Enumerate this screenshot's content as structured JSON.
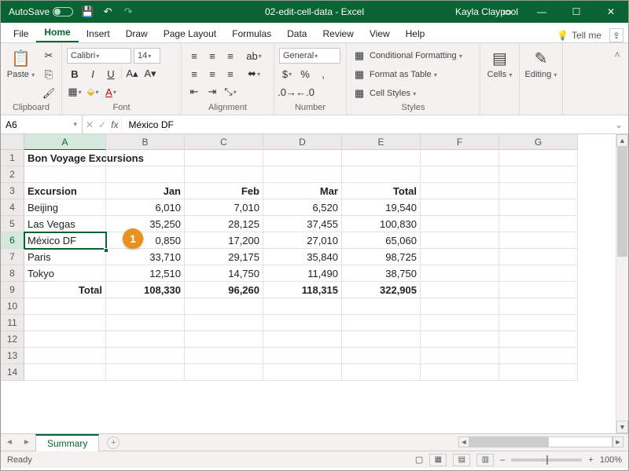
{
  "titlebar": {
    "autosave_label": "AutoSave",
    "autosave_state": "Off",
    "doc_title": "02-edit-cell-data - Excel",
    "user_name": "Kayla Claypool"
  },
  "tabs": {
    "file": "File",
    "home": "Home",
    "insert": "Insert",
    "draw": "Draw",
    "page_layout": "Page Layout",
    "formulas": "Formulas",
    "data": "Data",
    "review": "Review",
    "view": "View",
    "help": "Help",
    "tell_me": "Tell me"
  },
  "ribbon": {
    "clipboard": {
      "label": "Clipboard",
      "paste": "Paste"
    },
    "font": {
      "label": "Font",
      "name": "Calibri",
      "size": "14"
    },
    "alignment": {
      "label": "Alignment"
    },
    "number": {
      "label": "Number",
      "format": "General"
    },
    "styles": {
      "label": "Styles",
      "cond_fmt": "Conditional Formatting",
      "as_table": "Format as Table",
      "cell_styles": "Cell Styles"
    },
    "cells": {
      "label": "Cells"
    },
    "editing": {
      "label": "Editing"
    }
  },
  "namebox": "A6",
  "formula_value": "México DF",
  "columns": [
    "A",
    "B",
    "C",
    "D",
    "E",
    "F",
    "G"
  ],
  "rows": [
    "1",
    "2",
    "3",
    "4",
    "5",
    "6",
    "7",
    "8",
    "9",
    "10",
    "11",
    "12",
    "13",
    "14"
  ],
  "selected": {
    "col": 0,
    "row": 5
  },
  "cells": {
    "A1": {
      "v": "Bon Voyage Excursions",
      "bold": true
    },
    "A3": {
      "v": "Excursion",
      "bold": true
    },
    "B3": {
      "v": "Jan",
      "bold": true,
      "num": true
    },
    "C3": {
      "v": "Feb",
      "bold": true,
      "num": true
    },
    "D3": {
      "v": "Mar",
      "bold": true,
      "num": true
    },
    "E3": {
      "v": "Total",
      "bold": true,
      "num": true
    },
    "A4": {
      "v": "Beijing"
    },
    "B4": {
      "v": "6,010",
      "num": true
    },
    "C4": {
      "v": "7,010",
      "num": true
    },
    "D4": {
      "v": "6,520",
      "num": true
    },
    "E4": {
      "v": "19,540",
      "num": true
    },
    "A5": {
      "v": "Las Vegas"
    },
    "B5": {
      "v": "35,250",
      "num": true
    },
    "C5": {
      "v": "28,125",
      "num": true
    },
    "D5": {
      "v": "37,455",
      "num": true
    },
    "E5": {
      "v": "100,830",
      "num": true
    },
    "A6": {
      "v": "México DF"
    },
    "B6": {
      "v": "0,850",
      "num": true
    },
    "C6": {
      "v": "17,200",
      "num": true
    },
    "D6": {
      "v": "27,010",
      "num": true
    },
    "E6": {
      "v": "65,060",
      "num": true
    },
    "A7": {
      "v": "Paris"
    },
    "B7": {
      "v": "33,710",
      "num": true
    },
    "C7": {
      "v": "29,175",
      "num": true
    },
    "D7": {
      "v": "35,840",
      "num": true
    },
    "E7": {
      "v": "98,725",
      "num": true
    },
    "A8": {
      "v": "Tokyo"
    },
    "B8": {
      "v": "12,510",
      "num": true
    },
    "C8": {
      "v": "14,750",
      "num": true
    },
    "D8": {
      "v": "11,490",
      "num": true
    },
    "E8": {
      "v": "38,750",
      "num": true
    },
    "A9": {
      "v": "Total",
      "bold": true,
      "num": true
    },
    "B9": {
      "v": "108,330",
      "bold": true,
      "num": true
    },
    "C9": {
      "v": "96,260",
      "bold": true,
      "num": true
    },
    "D9": {
      "v": "118,315",
      "bold": true,
      "num": true
    },
    "E9": {
      "v": "322,905",
      "bold": true,
      "num": true
    }
  },
  "callout": {
    "number": "1"
  },
  "sheet_tab": "Summary",
  "status": {
    "mode": "Ready",
    "zoom": "100%"
  }
}
